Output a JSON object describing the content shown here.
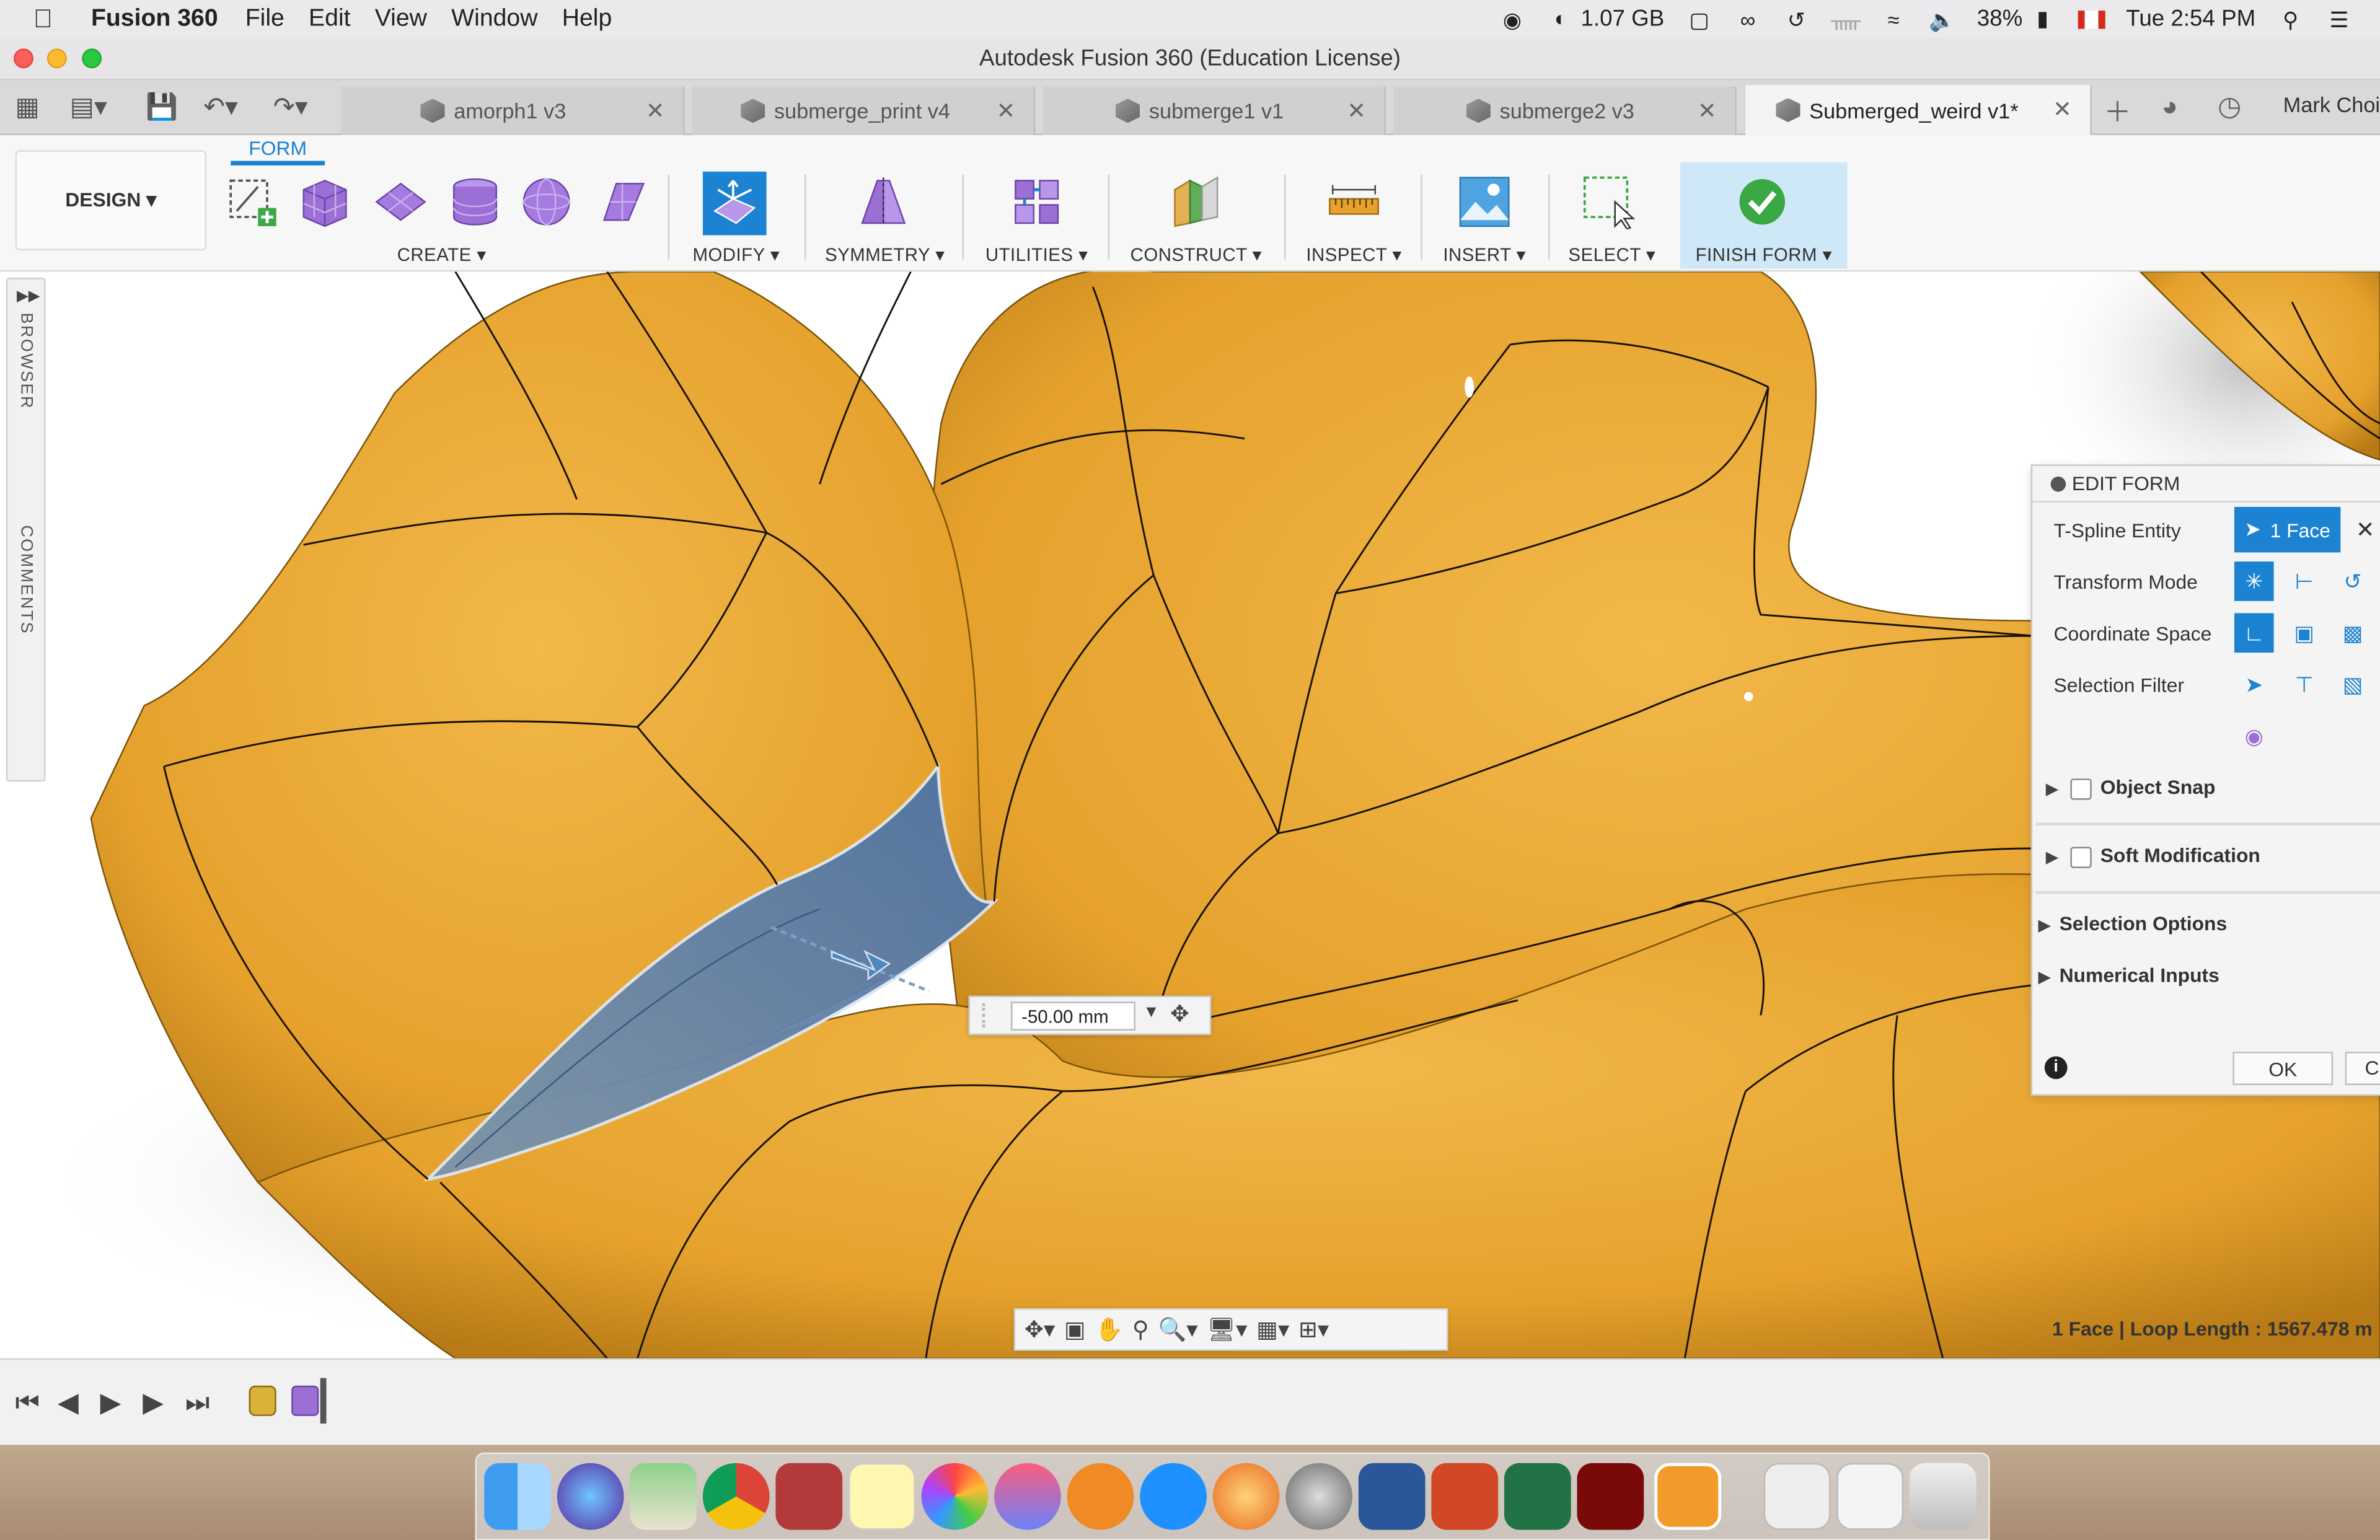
{
  "menubar": {
    "app_name": "Fusion 360",
    "menus": [
      "File",
      "Edit",
      "View",
      "Window",
      "Help"
    ],
    "memory": "1.07 GB",
    "battery": "38%",
    "clock": "Tue 2:54 PM"
  },
  "window": {
    "title": "Autodesk Fusion 360 (Education License)"
  },
  "tabs": [
    {
      "label": "amorph1 v3",
      "active": false
    },
    {
      "label": "submerge_print v4",
      "active": false
    },
    {
      "label": "submerge1 v1",
      "active": false
    },
    {
      "label": "submerge2 v3",
      "active": false
    },
    {
      "label": "Submerged_weird v1*",
      "active": true
    }
  ],
  "user": {
    "name": "Mark Choi"
  },
  "toolbar": {
    "workspace": "DESIGN ▾",
    "mode_tab": "FORM",
    "groups": {
      "create": "CREATE ▾",
      "modify": "MODIFY ▾",
      "symmetry": "SYMMETRY ▾",
      "utilities": "UTILITIES ▾",
      "construct": "CONSTRUCT ▾",
      "inspect": "INSPECT ▾",
      "insert": "INSERT ▾",
      "select": "SELECT ▾",
      "finish": "FINISH FORM ▾"
    }
  },
  "sidebar": {
    "browser": "BROWSER",
    "comments": "COMMENTS"
  },
  "edit_form": {
    "title": "EDIT FORM",
    "tspline_label": "T-Spline Entity",
    "tspline_value": "1 Face",
    "transform_label": "Transform Mode",
    "coord_label": "Coordinate Space",
    "filter_label": "Selection Filter",
    "object_snap": "Object Snap",
    "soft_mod": "Soft Modification",
    "sel_options": "Selection Options",
    "num_inputs": "Numerical Inputs",
    "ok": "OK",
    "cancel": "Ca"
  },
  "dimension": {
    "value": "-50.00 mm"
  },
  "status": "1 Face | Loop Length : 1567.478 m",
  "colors": {
    "accent": "#1c83d2",
    "surface": "#e8a22c",
    "selected_face": "#5a7ea8"
  }
}
